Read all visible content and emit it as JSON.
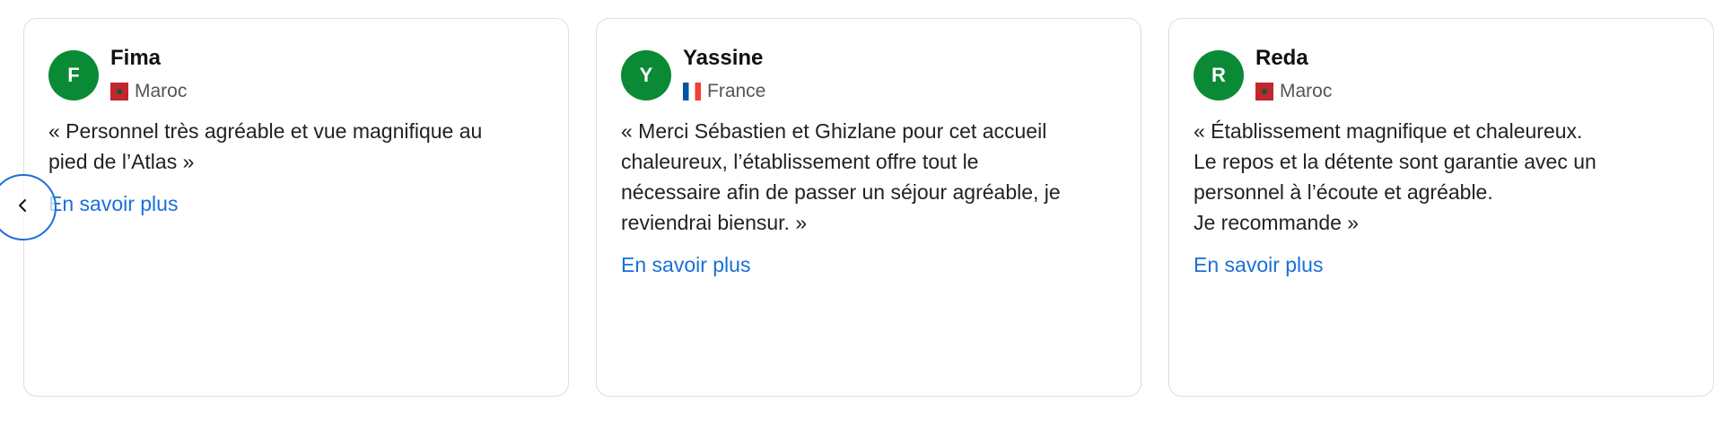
{
  "testimonials": [
    {
      "initial": "F",
      "name": "Fima",
      "country": "Maroc",
      "flag": "morocco-flag",
      "avatar_color": "#0a8a35",
      "quote": "« Personnel très agréable et vue magnifique au\npied de l’Atlas »",
      "link": "En savoir plus"
    },
    {
      "initial": "Y",
      "name": "Yassine",
      "country": "France",
      "flag": "france-flag",
      "avatar_color": "#0a8a35",
      "quote": "« Merci Sébastien et Ghizlane pour cet accueil\nchaleureux, l’établissement offre tout le\nnécessaire afin de passer un séjour agréable, je\nreviendrai biensur. »",
      "link": "En savoir plus"
    },
    {
      "initial": "R",
      "name": "Reda",
      "country": "Maroc",
      "flag": "morocco-flag",
      "avatar_color": "#0a8a35",
      "quote": "« Établissement magnifique et chaleureux.\nLe repos et la détente sont garantie avec un\npersonnel à l’écoute et agréable.\nJe recommande »",
      "link": "En savoir plus"
    }
  ],
  "carousel": {
    "prev_icon": "chevron-left-icon",
    "accent_color": "#1a6fd6"
  }
}
